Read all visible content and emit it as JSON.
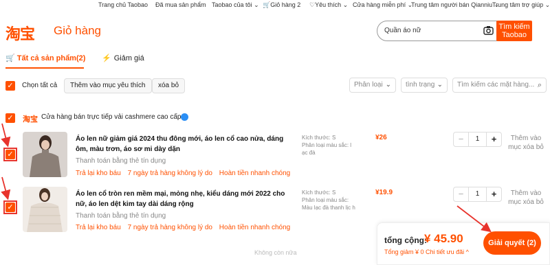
{
  "topnav": {
    "items": [
      "Trang chủ Taobao",
      "Đã mua sản phẩm",
      "Taobao của tôi",
      "Giỏ hàng 2",
      "Yêu thích",
      "Cửa hàng miễn phí",
      "Trung tâm người bán Qianniu",
      "Trung tâm trợ giúp"
    ]
  },
  "header": {
    "logo": "淘宝",
    "title": "Giỏ hàng",
    "search_value": "Quần áo nữ",
    "search_button": "Tìm kiếm Taobao"
  },
  "tabs": [
    {
      "label": "Tất cả sản phẩm(2)",
      "active": true
    },
    {
      "label": "Giảm giá",
      "active": false
    }
  ],
  "toolbar": {
    "select_all": "Chọn tất cả",
    "add_favorite": "Thêm vào mục yêu thích",
    "delete": "xóa bỏ",
    "filter_category": "Phân loại",
    "filter_status": "tình trạng",
    "search_placeholder": "Tìm kiếm các mặt hàng..."
  },
  "store": {
    "logo": "淘宝",
    "name": "Cửa hàng bán trực tiếp vải cashmere cao cấp"
  },
  "items": [
    {
      "title": "Áo len nữ giảm giá 2024 thu đông mới, áo len cổ cao nửa, dáng ôm, màu trơn, áo sơ mi dày dặn",
      "payment": "Thanh toán bằng thẻ tín dụng",
      "tags": [
        "Trả lại kho báu",
        "7 ngày trả hàng không lý do",
        "Hoàn tiền nhanh chóng"
      ],
      "sku": "Kích thước: S\nPhân loại màu sắc: l ạc đà",
      "price": "¥26",
      "quantity": "1",
      "actions": "Thêm vào mục xóa bỏ"
    },
    {
      "title": "Áo len cổ tròn ren mềm mại, mỏng nhẹ, kiểu dáng mới 2022 cho nữ, áo len dệt kim tay dài dáng rộng",
      "payment": "Thanh toán bằng thẻ tín dụng",
      "tags": [
        "Trả lại kho báu",
        "7 ngày trả hàng không lý do",
        "Hoàn tiền nhanh chóng"
      ],
      "sku": "Kích thước: S\nPhân loại màu sắc: Màu lạc đà thanh lịc h",
      "price": "¥19.9",
      "quantity": "1",
      "actions": "Thêm vào mục xóa bỏ"
    }
  ],
  "footer_note": "Không còn nữa",
  "summary": {
    "label": "tổng cộng:",
    "total": "¥ 45.90",
    "discount": "Tổng giảm  ¥ 0  Chi tiết ưu đãi ^",
    "checkout": "Giải quyết (2)"
  },
  "colors": {
    "accent": "#ff5000",
    "annotation": "#e8332c"
  }
}
